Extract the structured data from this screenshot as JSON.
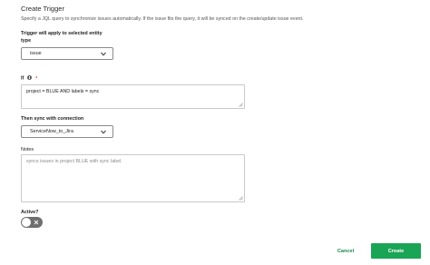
{
  "header": {
    "title": "Create Trigger",
    "description": "Specify a JQL query to synchronize issues automatically. If the issue fits the query, it will be synced on the create/update issue event."
  },
  "entity": {
    "heading": "Trigger will apply to selected entity",
    "type_label": "type",
    "selected_value": "issue"
  },
  "query": {
    "label": "If",
    "value": "project = BLUE AND labels = sync"
  },
  "connection": {
    "label": "Then sync with connection",
    "selected_value": "ServiceNow_to_Jira"
  },
  "notes": {
    "label": "Notes",
    "placeholder": "syncs issues in project BLUE with sync label."
  },
  "active": {
    "label": "Active?",
    "enabled": false
  },
  "actions": {
    "cancel_label": "Cancel",
    "create_label": "Create"
  },
  "colors": {
    "primary": "#1aa456",
    "cancel_text": "#1a8a4a",
    "required_marker": "#e0452b",
    "toggle_off": "#6f6f6f"
  },
  "icons": {
    "info": "info-icon",
    "dropdown": "chevron-down-icon",
    "toggle_off": "x-icon",
    "resize": "resize-handle-icon"
  }
}
